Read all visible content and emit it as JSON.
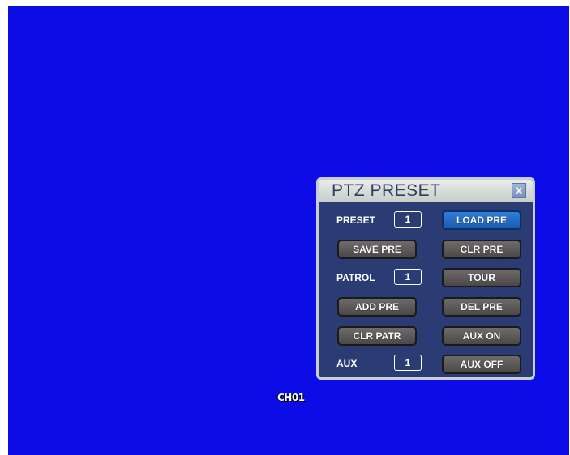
{
  "channel_label": "CH01",
  "panel": {
    "title": "PTZ PRESET",
    "close_label": "X",
    "preset_label": "PRESET",
    "preset_value": "1",
    "patrol_label": "PATROL",
    "patrol_value": "1",
    "aux_label": "AUX",
    "aux_value": "1",
    "buttons": {
      "load_pre": "LOAD PRE",
      "save_pre": "SAVE PRE",
      "clr_pre": "CLR PRE",
      "tour": "TOUR",
      "add_pre": "ADD PRE",
      "del_pre": "DEL PRE",
      "clr_patr": "CLR PATR",
      "aux_on": "AUX ON",
      "aux_off": "AUX OFF"
    }
  },
  "colors": {
    "screen_bg": "#0c0ce6",
    "panel_bg": "#2a3c73",
    "active_button": "#1b5cb0"
  }
}
